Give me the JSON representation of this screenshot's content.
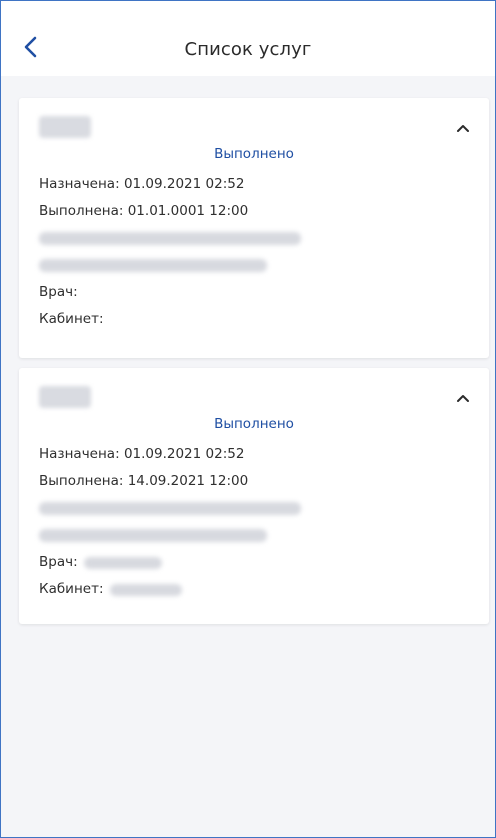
{
  "header": {
    "title": "Список услуг",
    "back_icon": "chevron-left-icon"
  },
  "colors": {
    "accent": "#1f4fa3",
    "background": "#f4f5f8",
    "card": "#ffffff"
  },
  "services": [
    {
      "status": "Выполнено",
      "assigned_label": "Назначена:",
      "assigned_value": "01.09.2021 02:52",
      "done_label": "Выполнена:",
      "done_value": "01.01.0001 12:00",
      "doctor_label": "Врач:",
      "cabinet_label": "Кабинет:",
      "expand_icon": "chevron-up-icon"
    },
    {
      "status": "Выполнено",
      "assigned_label": "Назначена:",
      "assigned_value": "01.09.2021 02:52",
      "done_label": "Выполнена:",
      "done_value": "14.09.2021 12:00",
      "doctor_label": "Врач:",
      "cabinet_label": "Кабинет:",
      "expand_icon": "chevron-up-icon"
    }
  ]
}
